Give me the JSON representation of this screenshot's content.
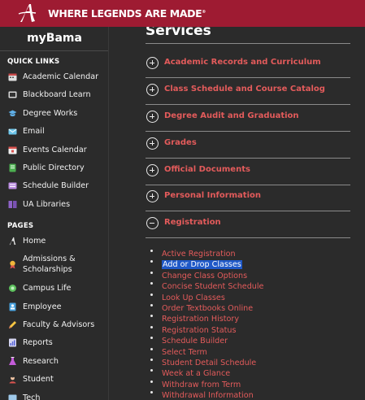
{
  "header": {
    "tagline": "WHERE LEGENDS ARE MADE",
    "trademark": "®",
    "brand_color": "#9e1b32"
  },
  "sidebar": {
    "brand": "myBama",
    "quick_links_heading": "QUICK LINKS",
    "quick_links": [
      {
        "label": "Academic Calendar",
        "icon": "calendar-icon"
      },
      {
        "label": "Blackboard Learn",
        "icon": "blackboard-icon"
      },
      {
        "label": "Degree Works",
        "icon": "degree-works-icon"
      },
      {
        "label": "Email",
        "icon": "email-icon"
      },
      {
        "label": "Events Calendar",
        "icon": "events-calendar-icon"
      },
      {
        "label": "Public Directory",
        "icon": "directory-icon"
      },
      {
        "label": "Schedule Builder",
        "icon": "schedule-builder-icon"
      },
      {
        "label": "UA Libraries",
        "icon": "library-icon"
      }
    ],
    "pages_heading": "PAGES",
    "pages": [
      {
        "label": "Home",
        "icon": "script-a-icon"
      },
      {
        "label": "Admissions & Scholarships",
        "icon": "award-ribbon-icon"
      },
      {
        "label": "Campus Life",
        "icon": "campus-life-icon"
      },
      {
        "label": "Employee",
        "icon": "employee-badge-icon"
      },
      {
        "label": "Faculty & Advisors",
        "icon": "pencil-icon"
      },
      {
        "label": "Reports",
        "icon": "reports-icon"
      },
      {
        "label": "Research",
        "icon": "flask-icon"
      },
      {
        "label": "Student",
        "icon": "student-icon"
      },
      {
        "label": "Tech",
        "icon": "tech-icon"
      }
    ]
  },
  "main": {
    "title": "Services",
    "accordion": [
      {
        "label": "Academic Records and Curriculum",
        "expanded": false
      },
      {
        "label": "Class Schedule and Course Catalog",
        "expanded": false
      },
      {
        "label": "Degree Audit and Graduation",
        "expanded": false
      },
      {
        "label": "Grades",
        "expanded": false
      },
      {
        "label": "Official Documents",
        "expanded": false
      },
      {
        "label": "Personal Information",
        "expanded": false
      },
      {
        "label": "Registration",
        "expanded": true
      }
    ],
    "registration_links": [
      {
        "label": "Active Registration",
        "selected": false
      },
      {
        "label": "Add or Drop Classes",
        "selected": true
      },
      {
        "label": "Change Class Options",
        "selected": false
      },
      {
        "label": "Concise Student Schedule",
        "selected": false
      },
      {
        "label": "Look Up Classes",
        "selected": false
      },
      {
        "label": "Order Textbooks Online",
        "selected": false
      },
      {
        "label": "Registration History",
        "selected": false
      },
      {
        "label": "Registration Status",
        "selected": false
      },
      {
        "label": "Schedule Builder",
        "selected": false
      },
      {
        "label": "Select Term",
        "selected": false
      },
      {
        "label": "Student Detail Schedule",
        "selected": false
      },
      {
        "label": "Week at a Glance",
        "selected": false
      },
      {
        "label": "Withdraw from Term",
        "selected": false
      },
      {
        "label": "Withdrawal Information",
        "selected": false
      }
    ],
    "link_color": "#e35b5b",
    "selection_color": "#1f58c7"
  }
}
